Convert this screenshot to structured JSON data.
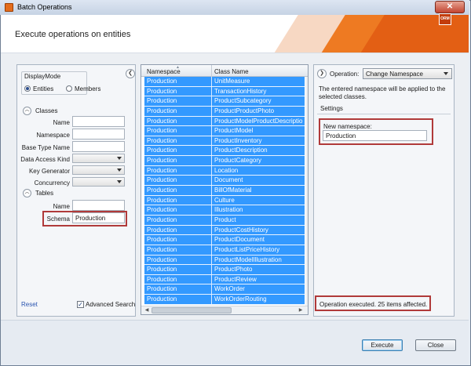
{
  "window": {
    "title": "Batch Operations",
    "close_glyph": "✕"
  },
  "header": {
    "title": "Execute operations on entities",
    "logo_text": "ORM"
  },
  "filters": {
    "display_mode": {
      "label": "DisplayMode",
      "options": [
        "Entities",
        "Members"
      ],
      "selected": "Entities"
    },
    "classes": {
      "label": "Classes",
      "fields": {
        "name": "Name",
        "namespace": "Namespace",
        "base_type_name": "Base Type Name",
        "data_access_kind": "Data Access Kind",
        "key_generator": "Key Generator",
        "concurrency": "Concurrency"
      }
    },
    "tables": {
      "label": "Tables",
      "name_label": "Name",
      "schema_label": "Schema",
      "schema_value": "Production"
    },
    "reset_label": "Reset",
    "advanced_search_label": "Advanced Search",
    "advanced_search_checked": true
  },
  "grid": {
    "columns": [
      "Namespace",
      "Class Name"
    ],
    "rows": [
      [
        "Production",
        "UnitMeasure"
      ],
      [
        "Production",
        "TransactionHistory"
      ],
      [
        "Production",
        "ProductSubcategory"
      ],
      [
        "Production",
        "ProductProductPhoto"
      ],
      [
        "Production",
        "ProductModelProductDescriptio"
      ],
      [
        "Production",
        "ProductModel"
      ],
      [
        "Production",
        "ProductInventory"
      ],
      [
        "Production",
        "ProductDescription"
      ],
      [
        "Production",
        "ProductCategory"
      ],
      [
        "Production",
        "Location"
      ],
      [
        "Production",
        "Document"
      ],
      [
        "Production",
        "BillOfMaterial"
      ],
      [
        "Production",
        "Culture"
      ],
      [
        "Production",
        "Illustration"
      ],
      [
        "Production",
        "Product"
      ],
      [
        "Production",
        "ProductCostHistory"
      ],
      [
        "Production",
        "ProductDocument"
      ],
      [
        "Production",
        "ProductListPriceHistory"
      ],
      [
        "Production",
        "ProductModelIllustration"
      ],
      [
        "Production",
        "ProductPhoto"
      ],
      [
        "Production",
        "ProductReview"
      ],
      [
        "Production",
        "WorkOrder"
      ],
      [
        "Production",
        "WorkOrderRouting"
      ]
    ]
  },
  "operation": {
    "label": "Operation:",
    "selected": "Change Namespace",
    "description": "The entered namespace will be applied to the selected classes.",
    "settings_label": "Settings",
    "new_namespace_label": "New namespace:",
    "new_namespace_value": "Production",
    "status": "Operation executed. 25 items affected."
  },
  "footer": {
    "execute_label": "Execute",
    "close_label": "Close"
  },
  "colors": {
    "selection": "#3399ff",
    "highlight": "#b03a3a",
    "accent": "#e35f14"
  }
}
